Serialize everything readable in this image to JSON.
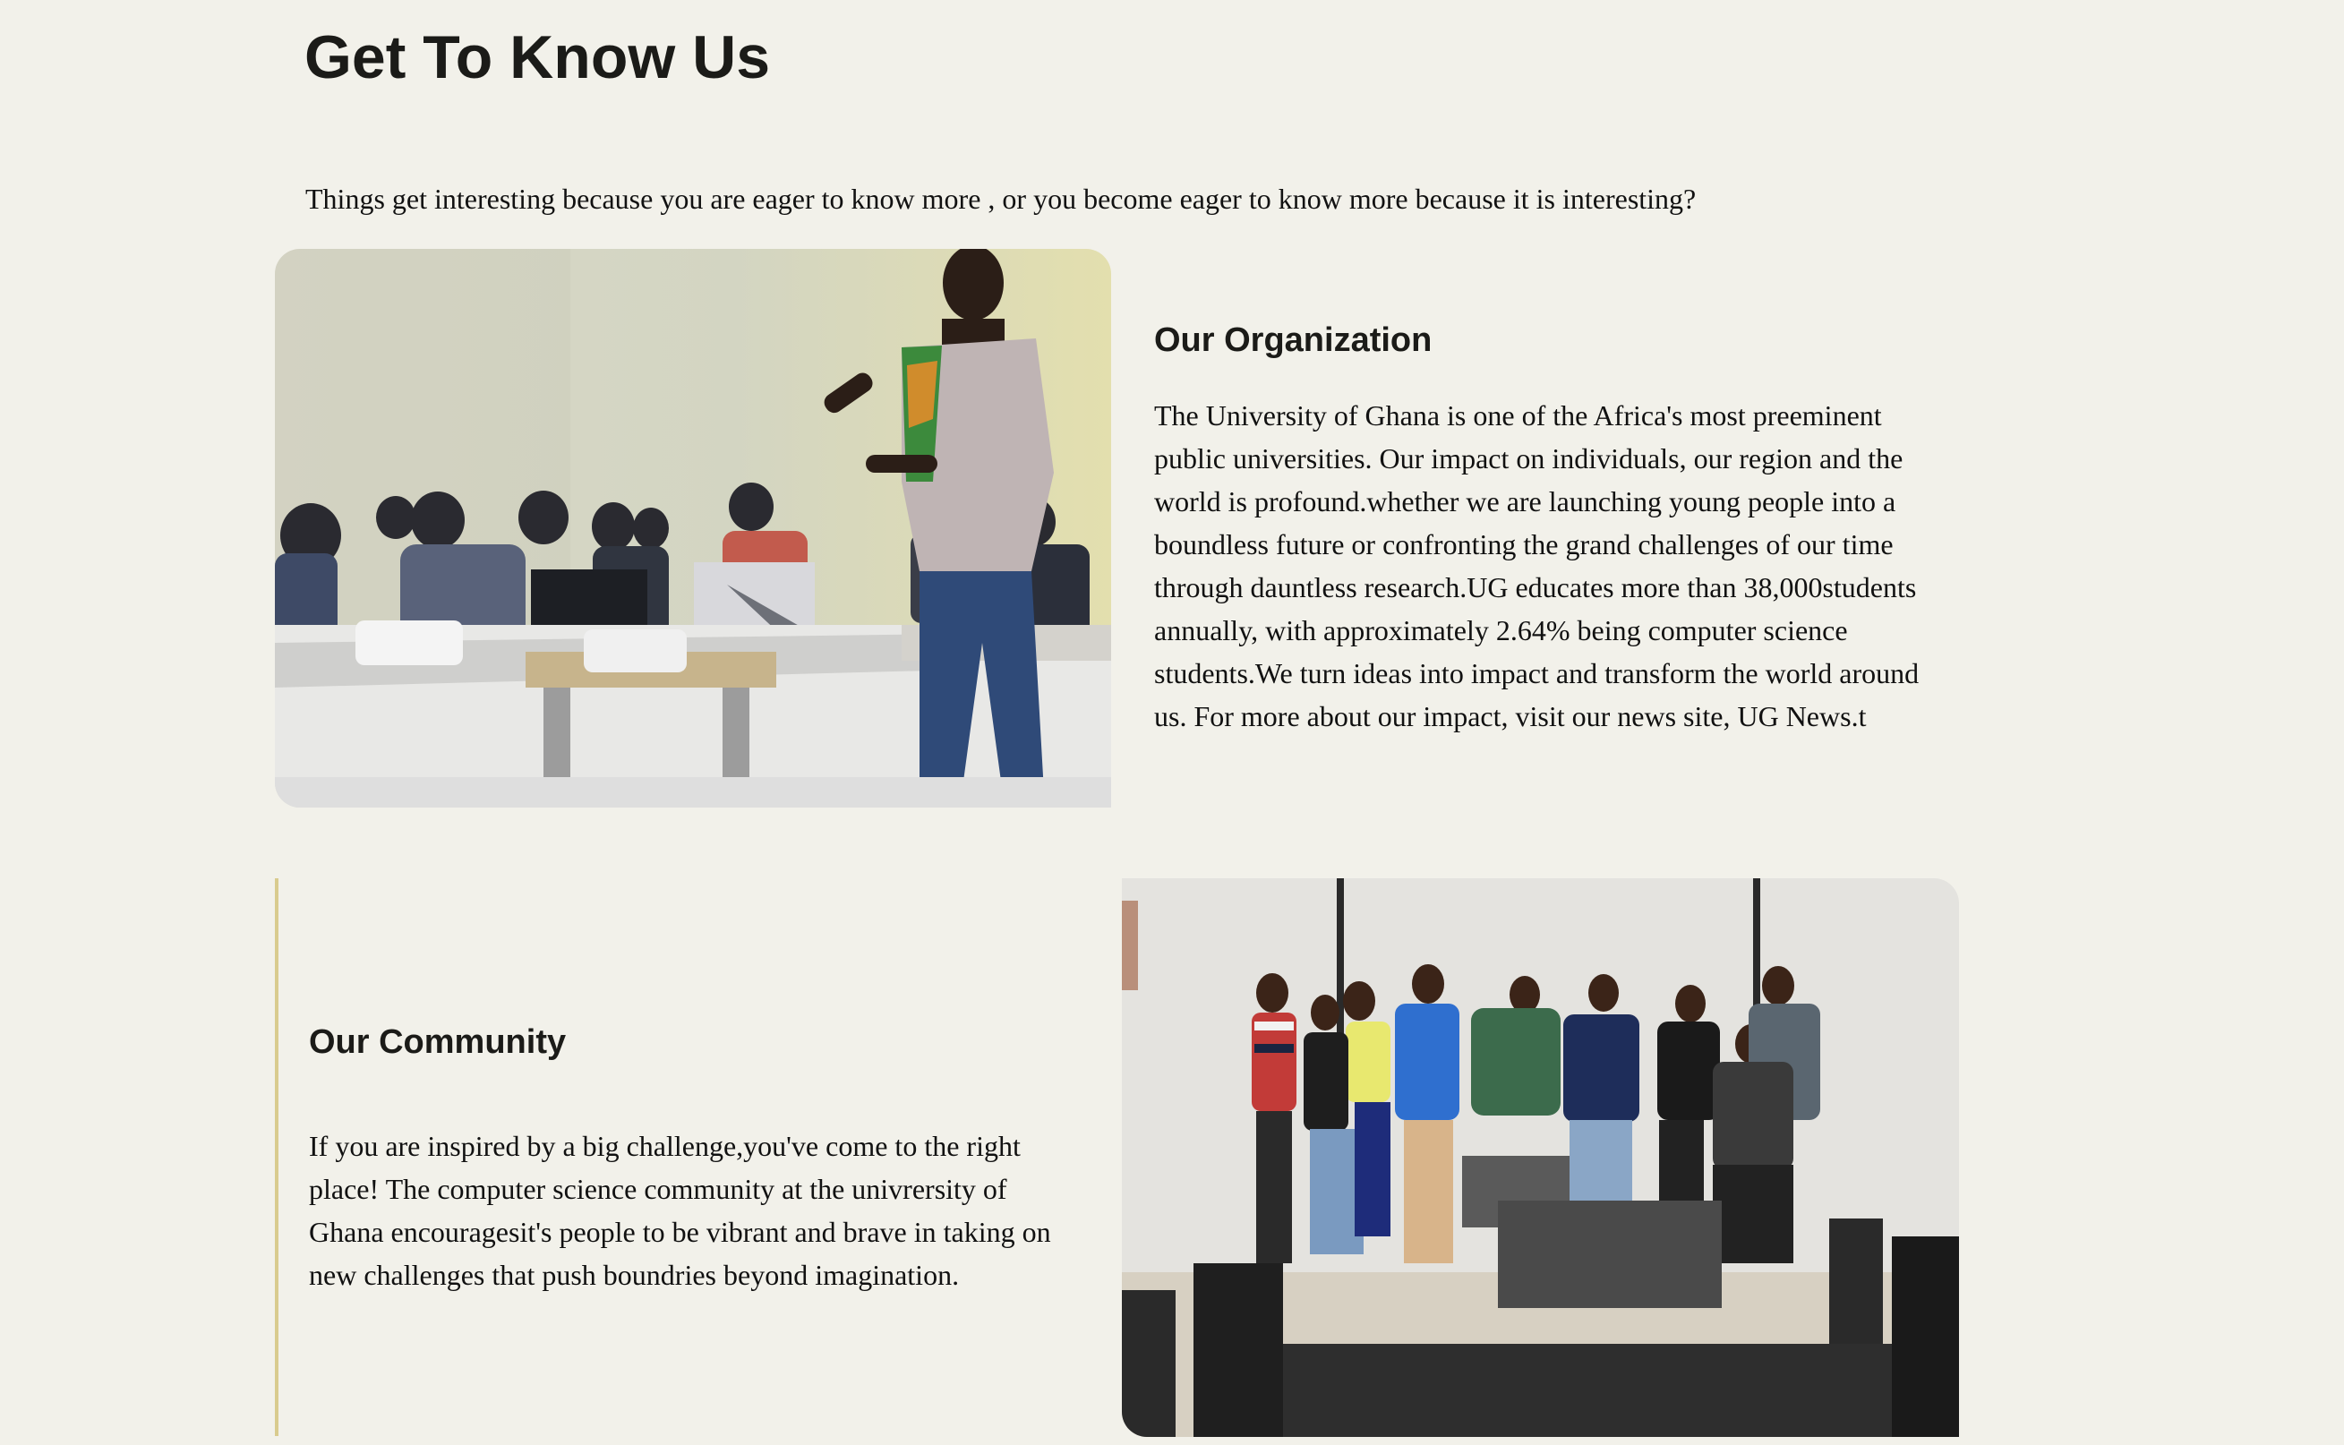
{
  "header": {
    "title": "Get To Know Us",
    "tagline": "Things get interesting because you are eager to know more , or you become eager to know more because it is interesting?"
  },
  "organization": {
    "heading": "Our Organization",
    "body": "The University of Ghana is one of the Africa's most preeminent public universities. Our impact on individuals, our region and the world is profound.whether we are launching young people into a boundless future or confronting the grand challenges of our time through dauntless research.UG educates more than 38,000students annually, with approximately 2.64% being computer science students.We turn ideas into impact and transform the world around us. For more about our impact, visit our news site, UG News.t"
  },
  "community": {
    "heading": "Our Community",
    "body": "If you are inspired by a big challenge,you've come to the right place! The computer science community at the univrersity of Ghana encouragesit's people to be vibrant and brave in taking on new challenges that push boundries beyond imagination."
  },
  "colors": {
    "background": "#f2f1ea",
    "accent_bar": "#d9cb8e",
    "heading_text": "#1b1b18"
  }
}
